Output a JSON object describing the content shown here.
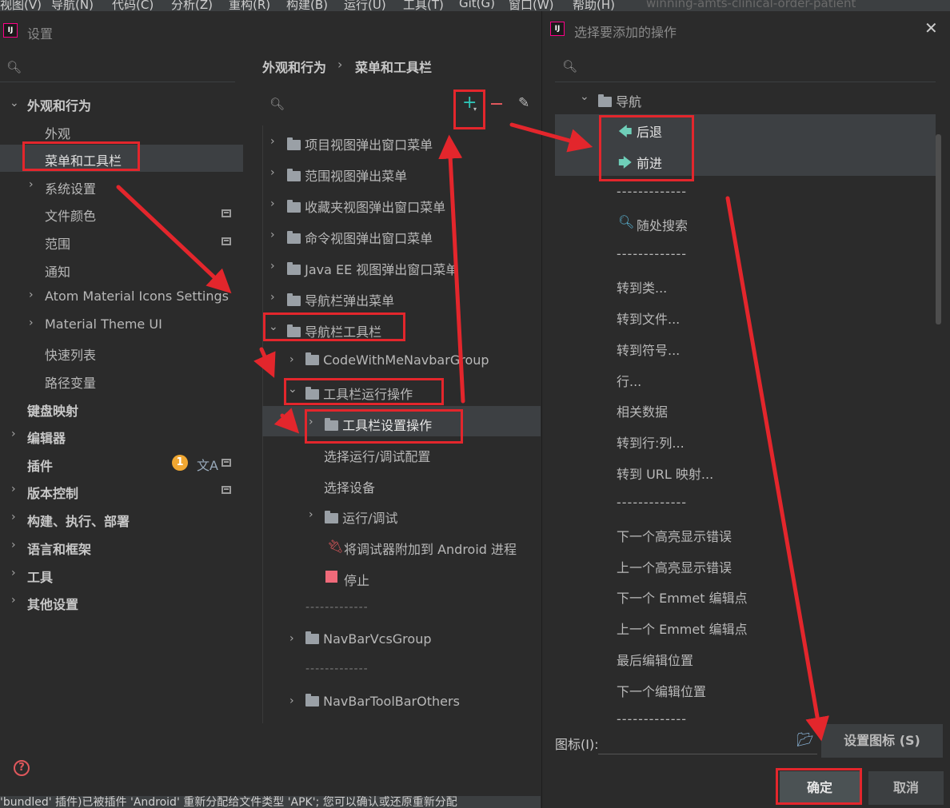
{
  "menubar": {
    "items": [
      "视图(V)",
      "导航(N)",
      "代码(C)",
      "分析(Z)",
      "重构(R)",
      "构建(B)",
      "运行(U)",
      "工具(T)",
      "Git(G)",
      "窗口(W)",
      "帮助(H)"
    ],
    "project_title": "winning-amts-clinical-order-patient"
  },
  "settings": {
    "title": "设置",
    "breadcrumb": {
      "parent": "外观和行为",
      "separator": "›",
      "current": "菜单和工具栏"
    },
    "nav": {
      "appearance_group": "外观和行为",
      "appearance": "外观",
      "menus_toolbars": "菜单和工具栏",
      "system_settings": "系统设置",
      "file_colors": "文件颜色",
      "scopes": "范围",
      "notifications": "通知",
      "atom_icons": "Atom Material Icons Settings",
      "material_theme": "Material Theme UI",
      "quick_lists": "快速列表",
      "path_variables": "路径变量",
      "keymap": "键盘映射",
      "editor": "编辑器",
      "plugins": "插件",
      "plugins_badge": "1",
      "vcs": "版本控制",
      "build": "构建、执行、部署",
      "languages": "语言和框架",
      "tools": "工具",
      "other": "其他设置"
    },
    "tree": {
      "project_view": "项目视图弹出窗口菜单",
      "scope_view": "范围视图弹出菜单",
      "favorites_view": "收藏夹视图弹出窗口菜单",
      "commander_view": "命令视图弹出窗口菜单",
      "javaee_view": "Java EE 视图弹出窗口菜单",
      "navbar_popup": "导航栏弹出菜单",
      "navbar_toolbar": "导航栏工具栏",
      "codewithme": "CodeWithMeNavbarGroup",
      "toolbar_run": "工具栏运行操作",
      "toolbar_settings": "工具栏设置操作",
      "select_run_config": "选择运行/调试配置",
      "select_device": "选择设备",
      "run_debug": "运行/调试",
      "attach_debugger": "将调试器附加到 Android 进程",
      "stop": "停止",
      "separator1": "-------------",
      "navbar_vcs": "NavBarVcsGroup",
      "separator2": "-------------",
      "navbar_others": "NavBarToolBarOthers"
    },
    "status_text": "'bundled' 插件)已被插件 'Android' 重新分配给文件类型 'APK'; 您可以确认或还原重新分配"
  },
  "add_action_dialog": {
    "title": "选择要添加的操作",
    "group": "导航",
    "actions": {
      "back": "后退",
      "forward": "前进",
      "sep1": "-------------",
      "search_everywhere": "随处搜索",
      "sep2": "-------------",
      "goto_class": "转到类...",
      "goto_file": "转到文件...",
      "goto_symbol": "转到符号...",
      "line": "行...",
      "related": "相关数据",
      "goto_line_col": "转到行:列...",
      "goto_url": "转到 URL 映射...",
      "sep3": "-------------",
      "next_error": "下一个高亮显示错误",
      "prev_error": "上一个高亮显示错误",
      "next_emmet": "下一个 Emmet 编辑点",
      "prev_emmet": "上一个 Emmet 编辑点",
      "last_edit": "最后编辑位置",
      "next_edit": "下一个编辑位置",
      "sep4": "-------------"
    },
    "icon_label": "图标(I):",
    "set_icon_button": "设置图标 (S)",
    "ok_button": "确定",
    "cancel_button": "取消"
  },
  "colors": {
    "annotation": "#e3262c",
    "accent_plus": "#2ec4b6",
    "minus": "#e0585c",
    "badge": "#f0a732"
  }
}
